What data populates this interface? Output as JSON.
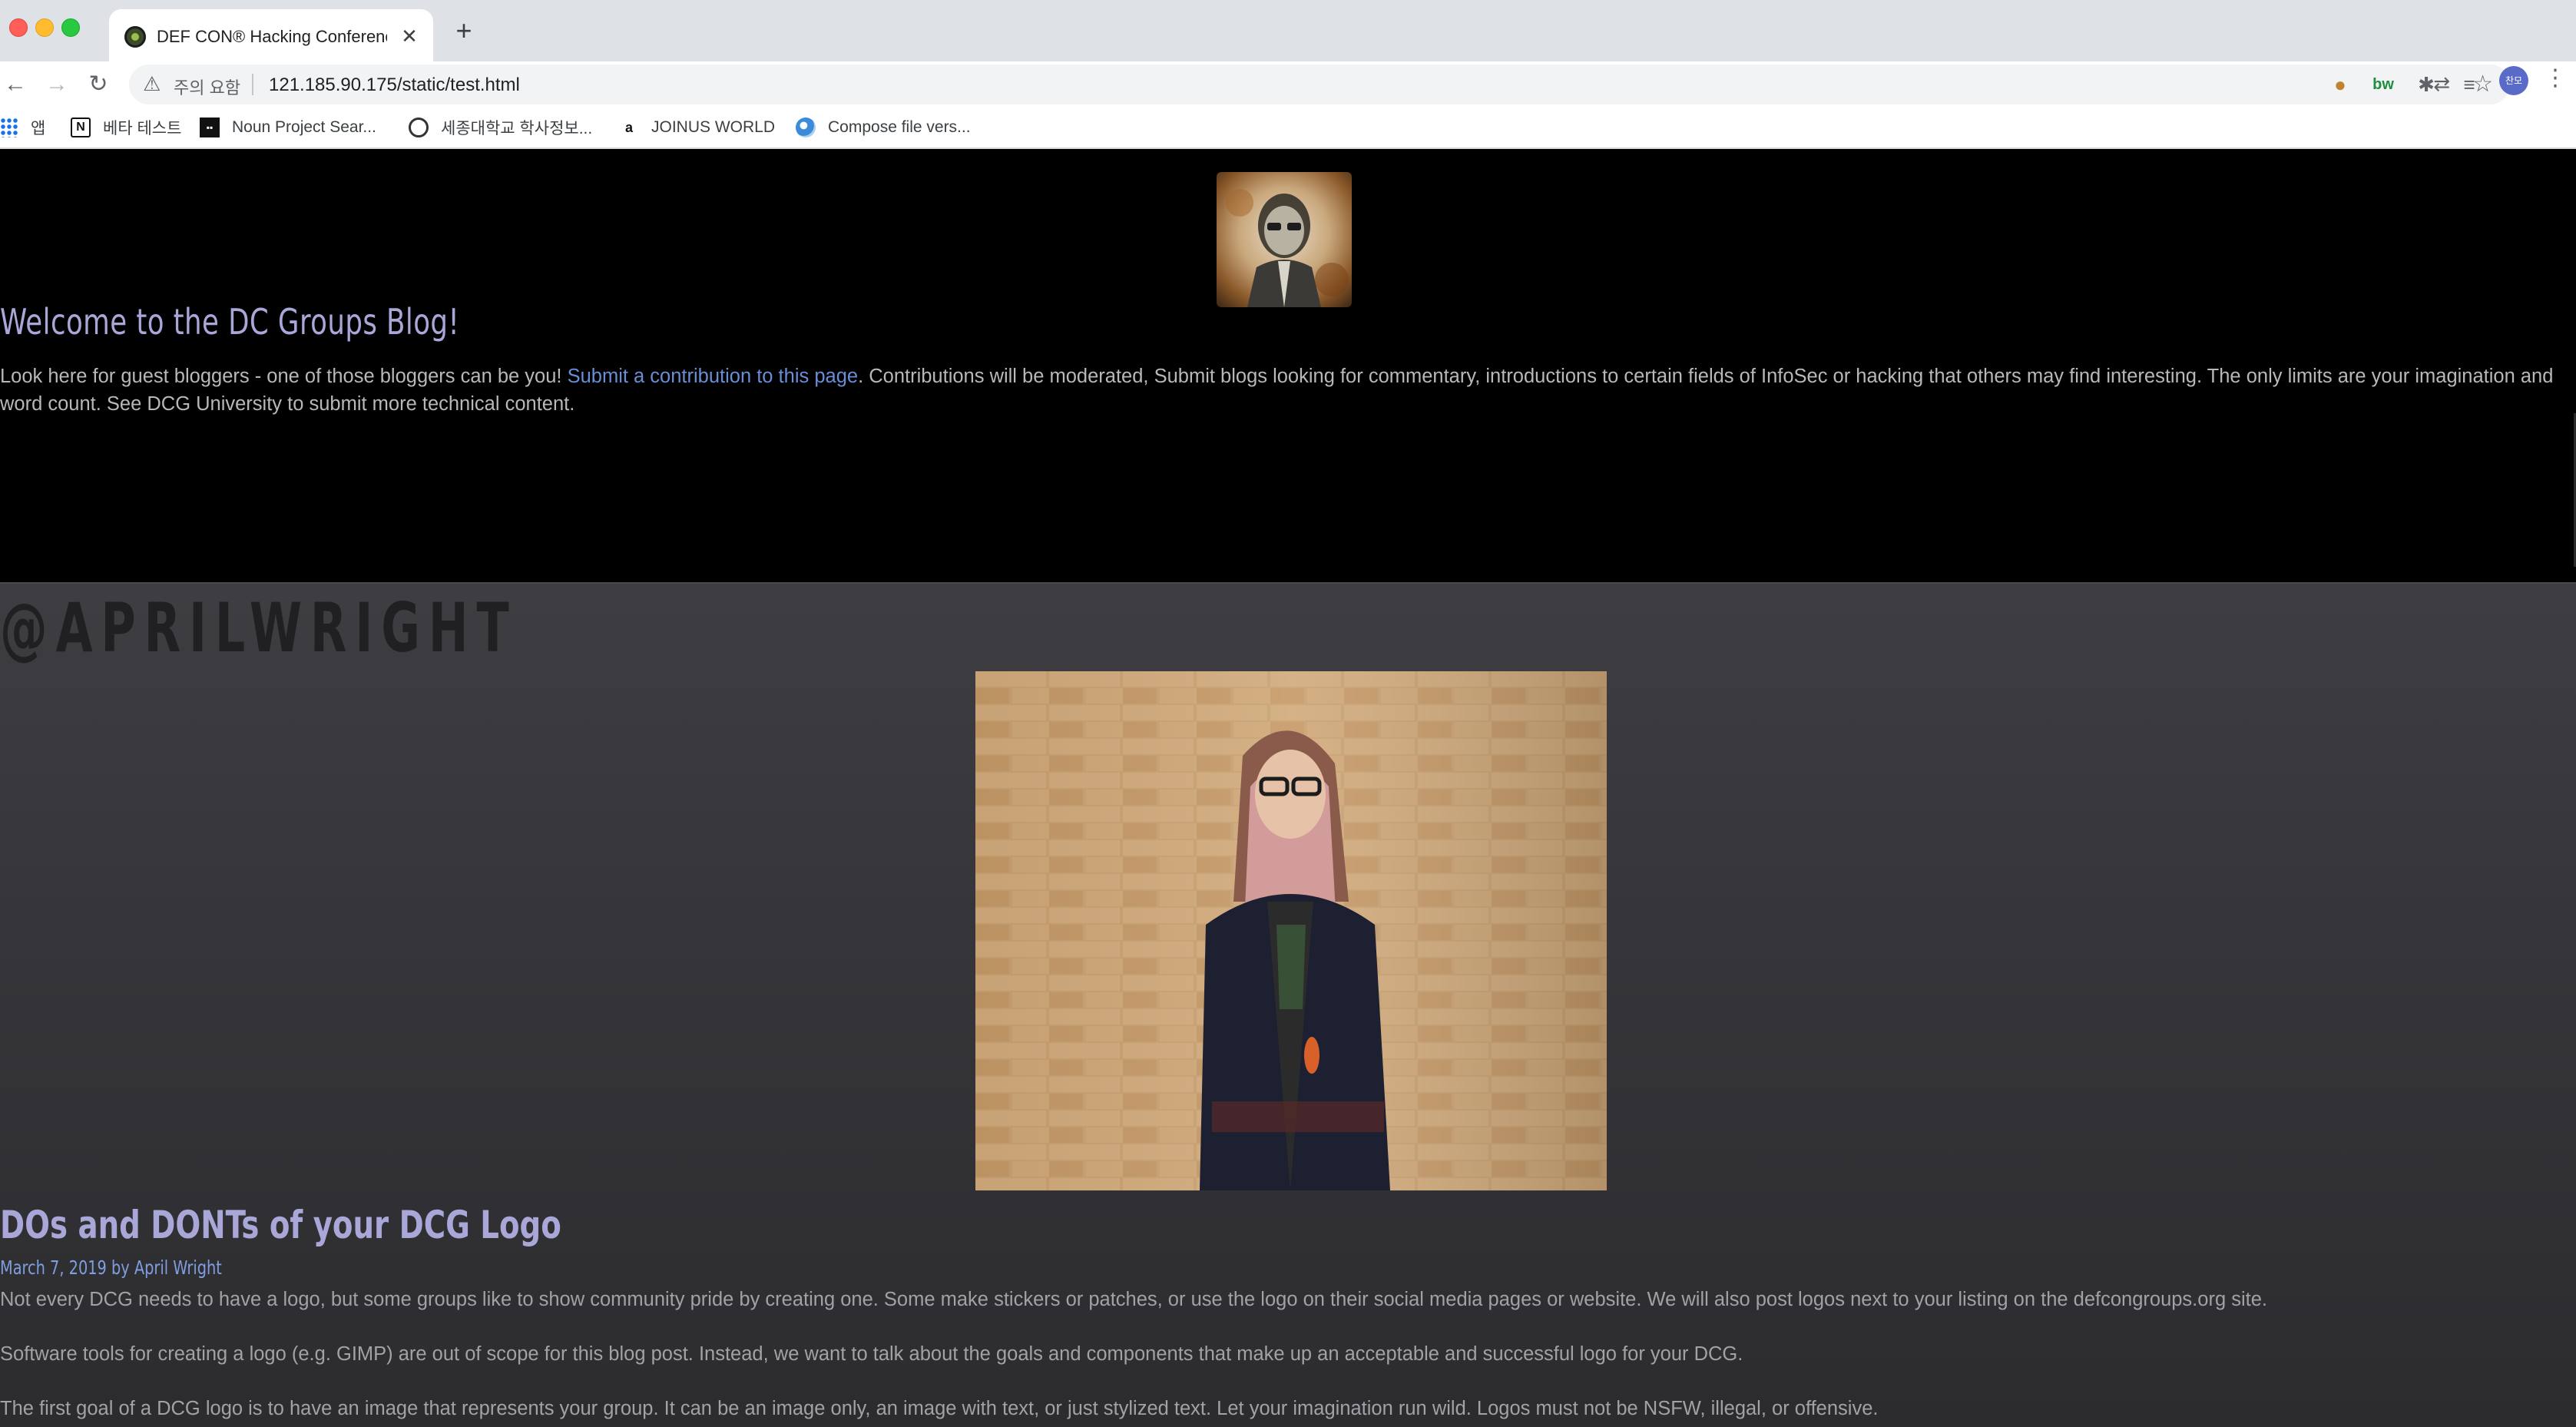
{
  "browser": {
    "tab": {
      "title": "DEF CON® Hacking Conference",
      "close_glyph": "✕"
    },
    "new_tab_glyph": "+",
    "nav": {
      "back": "←",
      "forward": "→",
      "reload": "↻"
    },
    "omnibox": {
      "warning_glyph": "⚠",
      "security_label": "주의 요함",
      "url": "121.185.90.175/static/test.html",
      "translate_glyph": "⇄",
      "star_glyph": "☆"
    },
    "extensions": [
      {
        "name": "cookie-icon",
        "glyph": "●"
      },
      {
        "name": "bw-icon",
        "glyph": "bw"
      },
      {
        "name": "puzzle-icon",
        "glyph": "✱"
      },
      {
        "name": "media-icon",
        "glyph": "≡"
      }
    ],
    "profile_label": "찬모",
    "menu_glyph": "⋮",
    "bookmarks": [
      {
        "label": "앱",
        "icon": "apps-grid-icon"
      },
      {
        "label": "베타 테스트",
        "icon": "notion-icon",
        "glyph": "N"
      },
      {
        "label": "Noun Project Sear...",
        "icon": "noun-project-icon",
        "glyph": "▪▪"
      },
      {
        "label": "세종대학교 학사정보...",
        "icon": "globe-icon",
        "glyph": ""
      },
      {
        "label": "JOINUS WORLD",
        "icon": "amazon-icon",
        "glyph": "a"
      },
      {
        "label": "Compose file vers...",
        "icon": "docker-icon",
        "glyph": ""
      }
    ]
  },
  "page": {
    "blog_title": "Welcome to the DC Groups Blog!",
    "intro": {
      "before_link": "Look here for guest bloggers - one of those bloggers can be you! ",
      "link": "Submit a contribution to this page",
      "after_link": ". Contributions will be moderated, Submit blogs looking for commentary, introductions to certain fields of InfoSec or hacking that others may find interesting. The only limits are your imagination and word count. See DCG University to submit more technical content."
    },
    "author_handle": "@APRILWRIGHT",
    "post": {
      "title": "DOs and DONTs of your DCG Logo",
      "meta": "March 7, 2019 by April Wright",
      "paragraphs": [
        "Not every DCG needs to have a logo, but some groups like to show community pride by creating one. Some make stickers or patches, or use the logo on their social media pages or website. We will also post logos next to your listing on the defcongroups.org site.",
        "Software tools for creating a logo (e.g. GIMP) are out of scope for this blog post. Instead, we want to talk about the goals and components that make up an acceptable and successful logo for your DCG.",
        "The first goal of a DCG logo is to have an image that represents your group. It can be an image only, an image with text, or just stylized text. Let your imagination run wild. Logos must not be NSFW, illegal, or offensive."
      ]
    }
  },
  "colors": {
    "page_background": "#000000",
    "section_background": "#3e3e42",
    "heading": "#a9a7d8",
    "link": "#6b8dd6",
    "body_text": "#a2a2a6"
  }
}
